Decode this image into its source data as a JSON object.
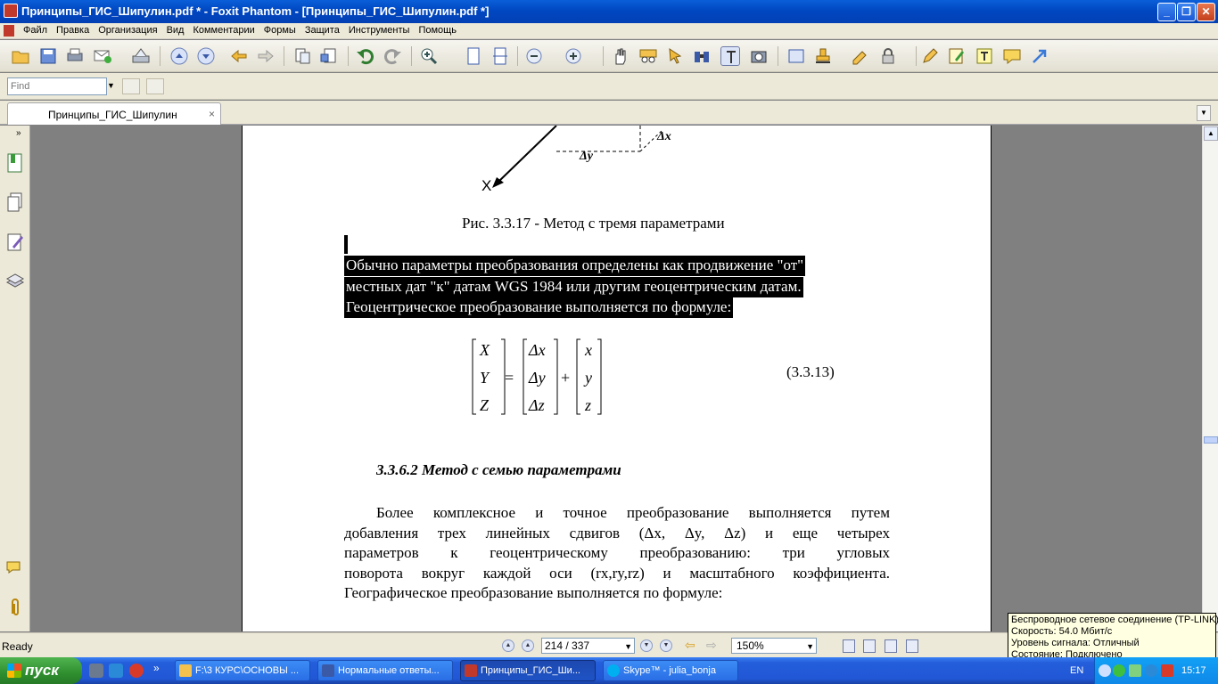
{
  "window": {
    "title": "Принципы_ГИС_Шипулин.pdf * - Foxit Phantom - [Принципы_ГИС_Шипулин.pdf *]",
    "minimize": "_",
    "restore": "❐",
    "close": "✕"
  },
  "menu": [
    "Файл",
    "Правка",
    "Организация",
    "Вид",
    "Комментарии",
    "Формы",
    "Защита",
    "Инструменты",
    "Помощь"
  ],
  "find": {
    "placeholder": "Find"
  },
  "tab": {
    "label": "Принципы_ГИС_Шипулин",
    "close": "×"
  },
  "document": {
    "figure_labels": {
      "dx": "Δx",
      "dy": "Δy",
      "x_axis": "X"
    },
    "caption": "Рис. 3.3.17 - Метод с тремя параметрами",
    "highlighted_lines": [
      "Обычно параметры преобразования определены как продвижение \"от\"",
      "местных дат \"к\" датам WGS 1984 или другим геоцентрическим датам.",
      "Геоцентрическое преобразование выполняется по формуле:"
    ],
    "equation": {
      "lhs": [
        "X",
        "Y",
        "Z"
      ],
      "shift": [
        "Δx",
        "Δy",
        "Δz"
      ],
      "rhs": [
        "x",
        "y",
        "z"
      ],
      "equals": "=",
      "plus": "+",
      "number": "(3.3.13)"
    },
    "section_heading": "3.3.6.2  Метод с семью параметрами",
    "paragraph_lines": [
      "Более комплексное и точное преобразование выполняется путем",
      "добавления трех линейных сдвигов (Δx, Δy, Δz) и еще четырех",
      "параметров к геоцентрическому преобразованию: три угловых",
      "поворота вокруг каждой оси (rx,ry,rz) и масштабного коэффициента.",
      "Географическое преобразование выполняется по формуле:"
    ]
  },
  "status": {
    "ready": "Ready",
    "page": "214 / 337",
    "zoom": "150%"
  },
  "tooltip": {
    "lines": [
      "Беспроводное сетевое соединение (TP-LINK)",
      "Скорость: 54.0 Мбит/с",
      "Уровень сигнала: Отличный",
      "Состояние: Подключено"
    ]
  },
  "taskbar": {
    "start": "пуск",
    "tasks": [
      "F:\\3 КУРС\\ОСНОВЫ ...",
      "Нормальные ответы...",
      "Принципы_ГИС_Ши...",
      "Skype™ - julia_bonja"
    ],
    "lang": "EN",
    "clock": "15:17"
  },
  "colors": {
    "titlebar": "#0a5fd8",
    "highlight_bg": "#000000",
    "taskbar": "#245edb",
    "start": "#2f8f2f"
  }
}
